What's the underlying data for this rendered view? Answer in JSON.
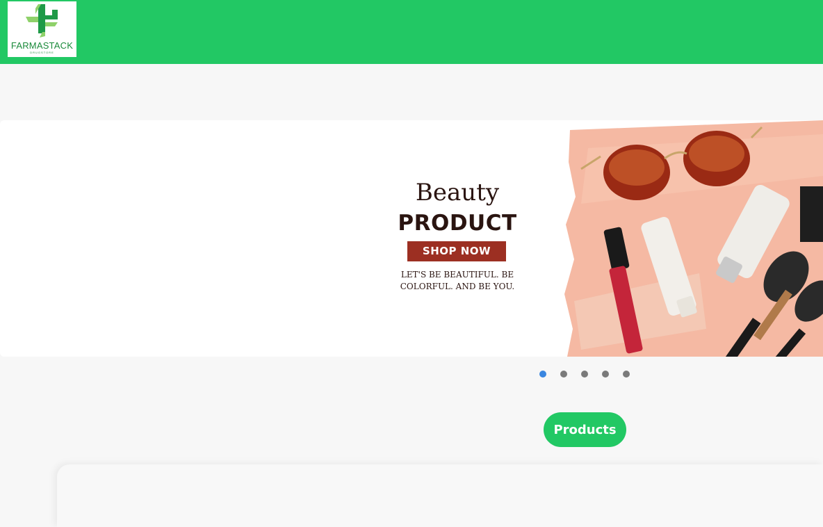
{
  "header": {
    "logo": {
      "name": "FARMASTACK",
      "subtitle": "DRUGSTORE",
      "icon": "cross-icon"
    }
  },
  "carousel": {
    "slide": {
      "title_line1": "Beauty",
      "title_line2": "PRODUCT",
      "cta_label": "SHOP NOW",
      "tagline": "LET'S BE BEAUTIFUL. BE COLORFUL. AND BE YOU."
    },
    "slide_count": 5,
    "active_index": 0
  },
  "products_button": {
    "label": "Products"
  },
  "colors": {
    "brand_green": "#22c864",
    "banner_cta": "#9c2f22",
    "active_dot": "#3a86e0",
    "inactive_dot": "#7a7a7a",
    "background": "#f7f7f7"
  }
}
